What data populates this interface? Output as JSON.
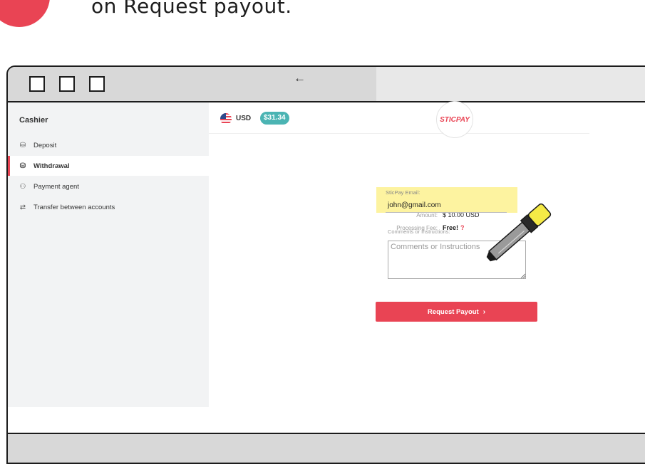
{
  "caption": "on Request payout.",
  "sidebar": {
    "title": "Cashier",
    "items": [
      {
        "label": "Deposit",
        "icon": "wallet-in-icon"
      },
      {
        "label": "Withdrawal",
        "icon": "wallet-out-icon"
      },
      {
        "label": "Payment agent",
        "icon": "payment-agent-icon"
      },
      {
        "label": "Transfer between accounts",
        "icon": "transfer-icon"
      }
    ],
    "active": "Withdrawal"
  },
  "account": {
    "currency": "USD",
    "balance": "$31.34",
    "flag": "us-flag-icon"
  },
  "payment": {
    "provider_logo": "STICPAY",
    "amount_label": "Amount:",
    "amount_value": "$ 10.00 USD",
    "fee_label": "Processing Fee:",
    "fee_value": "Free!",
    "fee_help": "?"
  },
  "email_field": {
    "label": "SticPay Email:",
    "value": "john@gmail.com"
  },
  "comments": {
    "label": "Comments or Instructions:",
    "placeholder": "Comments or Instructions"
  },
  "request_button": {
    "label": "Request Payout",
    "chevron": "›"
  },
  "colors": {
    "accent_red": "#e94454",
    "balance_teal": "#4bb4b3",
    "highlight_yellow": "#fdf3a0",
    "marker_yellow": "#f5ea46"
  }
}
